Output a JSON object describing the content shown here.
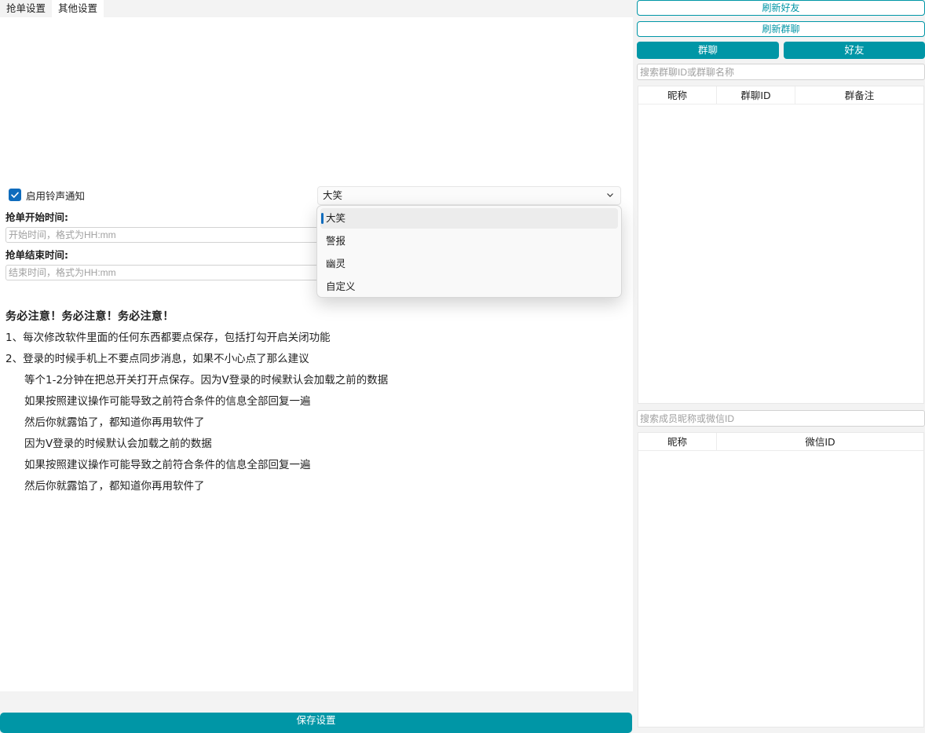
{
  "tabs": [
    {
      "label": "抢单设置",
      "active": false
    },
    {
      "label": "其他设置",
      "active": true
    }
  ],
  "settings": {
    "ring_checkbox_label": "启用铃声通知",
    "ring_checked": true,
    "sound_selected": "大笑",
    "sound_options": [
      "大笑",
      "警报",
      "幽灵",
      "自定义"
    ],
    "start_label": "抢单开始时间:",
    "start_placeholder": "开始时间，格式为HH:mm",
    "end_label": "抢单结束时间:",
    "end_placeholder": "结束时间，格式为HH:mm"
  },
  "notice": {
    "title": "务必注意！务必注意！务必注意！",
    "lines": [
      "1、每次修改软件里面的任何东西都要点保存，包括打勾开启关闭功能",
      "2、登录的时候手机上不要点同步消息，如果不小心点了那么建议",
      "等个1-2分钟在把总开关打开点保存。因为V登录的时候默认会加载之前的数据",
      "如果按照建议操作可能导致之前符合条件的信息全部回复一遍",
      "然后你就露馅了，都知道你再用软件了",
      "因为V登录的时候默认会加载之前的数据",
      "如果按照建议操作可能导致之前符合条件的信息全部回复一遍",
      "然后你就露馅了，都知道你再用软件了"
    ]
  },
  "save_button": "保存设置",
  "right_panel": {
    "refresh_friends": "刷新好友",
    "refresh_groups": "刷新群聊",
    "toggle_group": "群聊",
    "toggle_friend": "好友",
    "group_search_placeholder": "搜索群聊ID或群聊名称",
    "group_table_headers": [
      "昵称",
      "群聊ID",
      "群备注"
    ],
    "member_search_placeholder": "搜索成员昵称或微信ID",
    "member_table_headers": [
      "昵称",
      "微信ID"
    ]
  },
  "colors": {
    "accent": "#0096a6",
    "checkbox": "#0f6cbd"
  }
}
